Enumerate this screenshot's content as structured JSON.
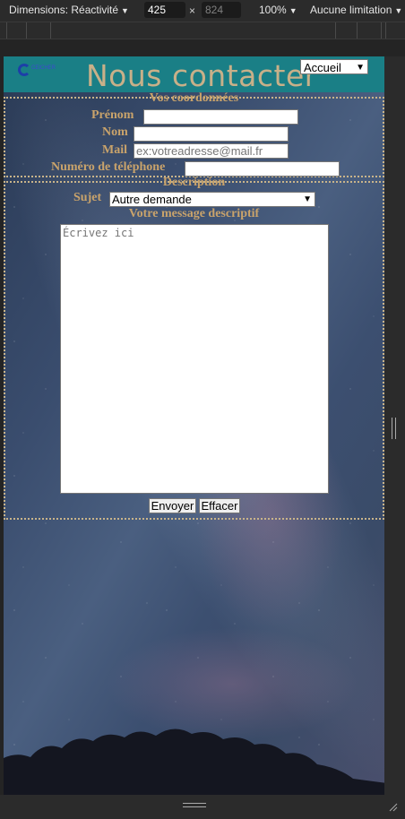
{
  "devtools": {
    "dimensions_label": "Dimensions: Réactivité",
    "width_value": "425",
    "times": "×",
    "height_value": "824",
    "zoom_label": "100%",
    "throttle_label": "Aucune limitation"
  },
  "header": {
    "logo_text": "CEICHER",
    "title": "Nous contacter",
    "nav_selected": "Accueil"
  },
  "coordonnees": {
    "legend": "Vos coordonnées",
    "prenom_label": "Prénom",
    "prenom_value": "",
    "nom_label": "Nom",
    "nom_value": "",
    "mail_label": "Mail",
    "mail_placeholder": "ex:votreadresse@mail.fr",
    "tel_label": "Numéro de téléphone",
    "tel_value": ""
  },
  "description": {
    "legend": "Description",
    "sujet_label": "Sujet",
    "sujet_selected": "Autre demande",
    "message_label": "Votre message descriptif",
    "message_placeholder": "Écrivez ici",
    "send_button": "Envoyer",
    "reset_button": "Effacer"
  }
}
